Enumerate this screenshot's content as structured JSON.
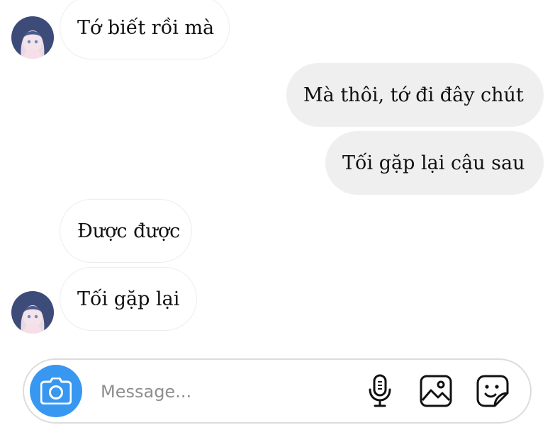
{
  "conversation": {
    "messages": [
      {
        "text": "Tớ biết rồi mà",
        "direction": "received"
      },
      {
        "text": "Mà thôi, tớ đi đây chút",
        "direction": "sent"
      },
      {
        "text": "Tối gặp lại cậu sau",
        "direction": "sent"
      },
      {
        "text": "Được được",
        "direction": "received"
      },
      {
        "text": "Tối gặp lại",
        "direction": "received"
      }
    ]
  },
  "composer": {
    "placeholder": "Message...",
    "camera_icon": "camera-icon",
    "mic_icon": "microphone-icon",
    "gallery_icon": "image-icon",
    "sticker_icon": "sticker-icon"
  },
  "colors": {
    "accent": "#3897f0",
    "sent_bubble": "#efefef",
    "received_border": "#ededed",
    "avatar_hair": "#3d4b78"
  }
}
